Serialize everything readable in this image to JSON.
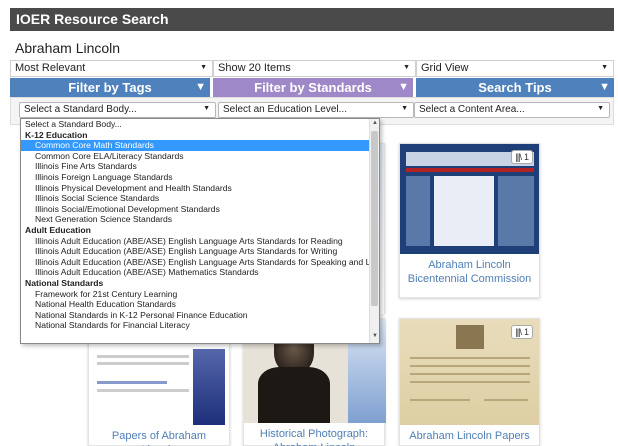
{
  "header": {
    "title": "IOER Resource Search"
  },
  "search": {
    "value": "Abraham Lincoln"
  },
  "sort": {
    "relevance": "Most Relevant",
    "items": "Show 20 Items",
    "view": "Grid View"
  },
  "tabs": {
    "tags": "Filter by Tags",
    "standards": "Filter by Standards",
    "tips": "Search Tips"
  },
  "filters": {
    "standard_body": "Select a Standard Body...",
    "education_level": "Select an Education Level...",
    "content_area": "Select a Content Area..."
  },
  "dropdown": {
    "options": [
      {
        "label": "Select a Standard Body...",
        "kind": "first"
      },
      {
        "label": "K-12 Education",
        "kind": "group"
      },
      {
        "label": "Common Core Math Standards",
        "kind": "selected"
      },
      {
        "label": "Common Core ELA/Literacy Standards",
        "kind": "item"
      },
      {
        "label": "Illinois Fine Arts Standards",
        "kind": "item"
      },
      {
        "label": "Illinois Foreign Language Standards",
        "kind": "item"
      },
      {
        "label": "Illinois Physical Development and Health Standards",
        "kind": "item"
      },
      {
        "label": "Illinois Social Science Standards",
        "kind": "item"
      },
      {
        "label": "Illinois Social/Emotional Development Standards",
        "kind": "item"
      },
      {
        "label": "Next Generation Science Standards",
        "kind": "item"
      },
      {
        "label": "Adult Education",
        "kind": "group"
      },
      {
        "label": "Illinois Adult Education (ABE/ASE) English Language Arts Standards for Reading",
        "kind": "item"
      },
      {
        "label": "Illinois Adult Education (ABE/ASE) English Language Arts Standards for Writing",
        "kind": "item"
      },
      {
        "label": "Illinois Adult Education (ABE/ASE) English Language Arts Standards for Speaking and Listening",
        "kind": "item"
      },
      {
        "label": "Illinois Adult Education (ABE/ASE) Mathematics Standards",
        "kind": "item"
      },
      {
        "label": "National Standards",
        "kind": "group"
      },
      {
        "label": "Framework for 21st Century Learning",
        "kind": "item"
      },
      {
        "label": "National Health Education Standards",
        "kind": "item"
      },
      {
        "label": "National Standards in K-12 Personal Finance Education",
        "kind": "item"
      },
      {
        "label": "National Standards for Financial Literacy",
        "kind": "item"
      }
    ]
  },
  "results": {
    "r1": {
      "caption": "Abraham Lincoln Bicentennial Commission",
      "count": "1"
    },
    "r2": {
      "caption": "Papers of Abraham Lincoln"
    },
    "r3": {
      "caption": "Historical Photograph: Abraham Lincoln"
    },
    "r4": {
      "caption": "Abraham Lincoln Papers",
      "count": "1"
    }
  },
  "icons": {
    "library": "library-icon",
    "dropdown_arrow": "chevron-down-icon",
    "tab_arrow": "triangle-down-icon"
  },
  "colors": {
    "header_bg": "#4a4a4a",
    "tab_blue": "#4f81bd",
    "tab_purple": "#9f88c8",
    "selected_option": "#3399ff",
    "link": "#4f7fb5"
  }
}
